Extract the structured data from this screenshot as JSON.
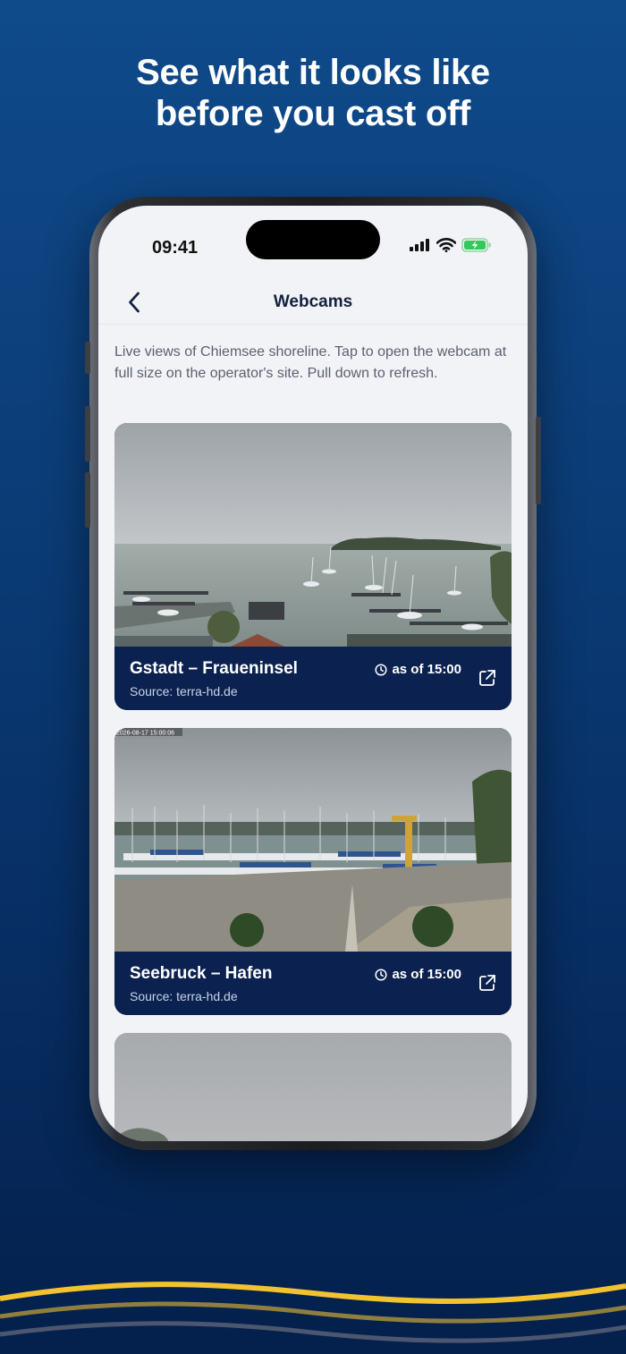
{
  "headline": {
    "line1": "See what it looks like",
    "line2": "before you cast off"
  },
  "status_bar": {
    "time": "09:41"
  },
  "nav": {
    "title": "Webcams",
    "back_icon": "chevron-left-icon"
  },
  "intro_text": "Live views of Chiemsee shoreline. Tap to open the webcam at full size on the operator's site. Pull down to refresh.",
  "webcams": [
    {
      "title": "Gstadt – Fraueninsel",
      "source": "Source: terra-hd.de",
      "as_of": "as of 15:00"
    },
    {
      "title": "Seebruck – Hafen",
      "source": "Source: terra-hd.de",
      "as_of": "as of 15:00",
      "overlay_timestamp": "2026-08-17 15:00:06"
    }
  ],
  "colors": {
    "background_top": "#0f4a8a",
    "background_bottom": "#04204c",
    "card_caption": "#0b2250",
    "wave_gold": "#f2c230",
    "battery_green": "#34c759"
  }
}
